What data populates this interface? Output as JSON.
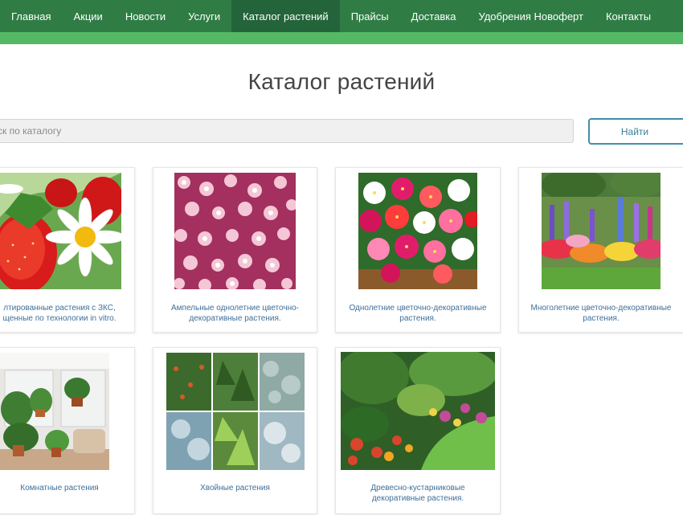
{
  "nav": {
    "items": [
      {
        "label": "Главная"
      },
      {
        "label": "Акции"
      },
      {
        "label": "Новости"
      },
      {
        "label": "Услуги"
      },
      {
        "label": "Каталог растений",
        "active": true
      },
      {
        "label": "Прайсы"
      },
      {
        "label": "Доставка"
      },
      {
        "label": "Удобрения Новоферт"
      },
      {
        "label": "Контакты"
      }
    ]
  },
  "page": {
    "title": "Каталог растений"
  },
  "search": {
    "placeholder": "ск по каталогу",
    "button_label": "Найти"
  },
  "catalog": {
    "items": [
      {
        "caption_line1": "лтированные растения с ЗКС,",
        "caption_line2": "щенные по технологии in vitro.",
        "image": "strawberry-daisy-photo"
      },
      {
        "caption_line1": "Ампельные однолетние цветочно-",
        "caption_line2": "декоративные растения.",
        "image": "pink-alyssum-photo"
      },
      {
        "caption_line1": "Однолетние цветочно-декоративные",
        "caption_line2": "растения.",
        "image": "impatiens-photo"
      },
      {
        "caption_line1": "Многолетние цветочно-декоративные",
        "caption_line2": "растения.",
        "image": "perennial-garden-photo"
      },
      {
        "caption_line1": "Комнатные растения",
        "caption_line2": "",
        "image": "houseplants-photo"
      },
      {
        "caption_line1": "Хвойные растения",
        "caption_line2": "",
        "image": "conifers-collage-photo"
      },
      {
        "caption_line1": "Древесно-кустарниковые",
        "caption_line2": "декоративные растения.",
        "image": "shrub-garden-photo"
      }
    ]
  },
  "colors": {
    "nav_background": "#2f7d45",
    "nav_active": "#23643a",
    "nav_strip": "#54b865",
    "link": "#3d6f9a",
    "button_border": "#3f8fa8"
  }
}
